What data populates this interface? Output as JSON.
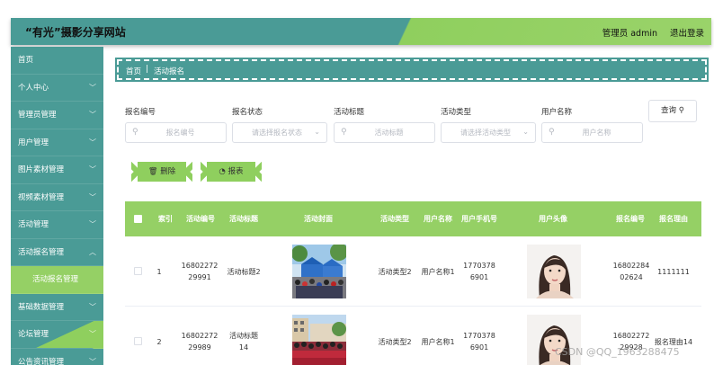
{
  "header": {
    "title": "“有光”摄影分享网站",
    "admin": "管理员 admin",
    "logout": "退出登录"
  },
  "sidebar": {
    "items": [
      {
        "label": "首页",
        "chevron": ""
      },
      {
        "label": "个人中心",
        "chevron": "﹀"
      },
      {
        "label": "管理员管理",
        "chevron": "﹀"
      },
      {
        "label": "用户管理",
        "chevron": "﹀"
      },
      {
        "label": "图片素材管理",
        "chevron": "﹀"
      },
      {
        "label": "视频素材管理",
        "chevron": "﹀"
      },
      {
        "label": "活动管理",
        "chevron": "﹀"
      },
      {
        "label": "活动报名管理",
        "chevron": "︿"
      },
      {
        "label": "活动报名管理",
        "chevron": ""
      },
      {
        "label": "基础数据管理",
        "chevron": "﹀"
      },
      {
        "label": "论坛管理",
        "chevron": "﹀"
      },
      {
        "label": "公告资讯管理",
        "chevron": "﹀"
      }
    ]
  },
  "breadcrumb": {
    "home": "首页",
    "separator": "|",
    "current": "活动报名"
  },
  "filters": {
    "labels": [
      "报名编号",
      "报名状态",
      "活动标题",
      "活动类型",
      "用户名称"
    ],
    "placeholders": [
      "报名编号",
      "请选择报名状态",
      "活动标题",
      "请选择活动类型",
      "用户名称"
    ],
    "query": "查询"
  },
  "actions": {
    "delete": "删除",
    "report": "报表"
  },
  "table": {
    "headers": [
      "索引",
      "活动编号",
      "活动标题",
      "活动封面",
      "活动类型",
      "用户名称",
      "用户手机号",
      "用户头像",
      "报名编号",
      "报名理由"
    ],
    "rows": [
      {
        "index": "1",
        "activity_no": "1680227229991",
        "title": "活动标题2",
        "type": "活动类型2",
        "user": "用户名称1",
        "phone": "17703786901",
        "signup_no": "1680228402624",
        "reason": "1111111"
      },
      {
        "index": "2",
        "activity_no": "1680227229989",
        "title": "活动标题14",
        "type": "活动类型2",
        "user": "用户名称1",
        "phone": "17703786901",
        "signup_no": "1680227229928",
        "reason": "报名理由14"
      }
    ]
  },
  "icons": {
    "search": "search-icon",
    "dropdown": "chevron-down-icon",
    "delete": "trash-icon",
    "report": "pie-chart-icon"
  },
  "colors": {
    "teal": "#4a9b96",
    "green": "#95d065"
  },
  "watermark": "CSDN @QQ_1963288475"
}
